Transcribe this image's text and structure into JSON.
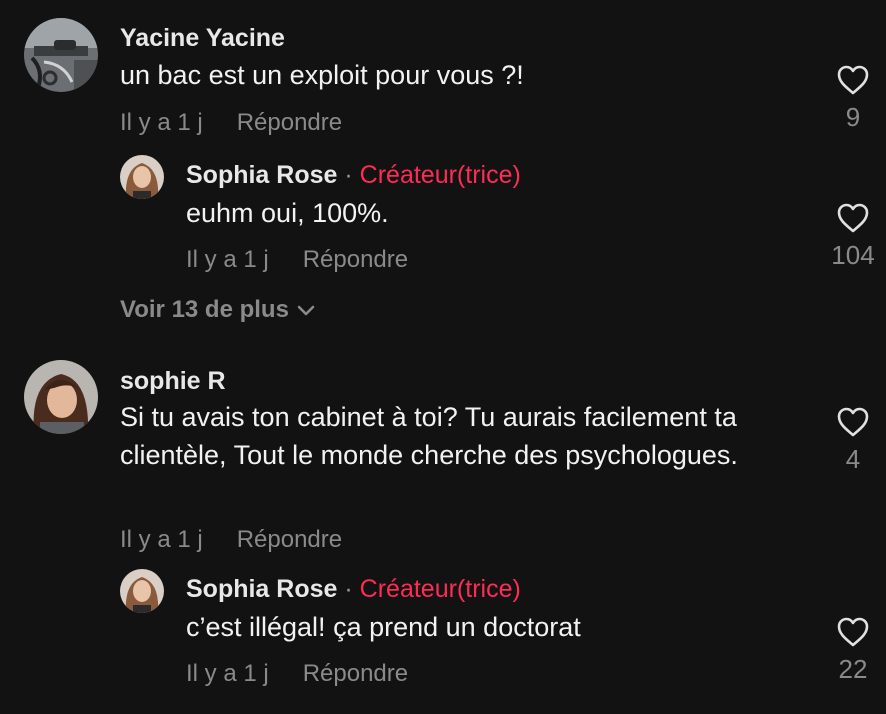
{
  "comments": [
    {
      "user": "Yacine Yacine",
      "text": "un bac est un exploit pour vous ?!",
      "time": "Il y a 1 j",
      "reply": "Répondre",
      "likes": "9"
    },
    {
      "user": "sophie R",
      "text": "Si tu avais ton cabinet à toi? Tu aurais facilement ta clientèle, Tout le monde cherche des psychologues.",
      "time": "Il y a 1 j",
      "reply": "Répondre",
      "likes": "4"
    }
  ],
  "replies": [
    {
      "user": "Sophia Rose",
      "separator": "·",
      "badge": "Créateur(trice)",
      "text": "euhm oui, 100%.",
      "time": "Il y a 1 j",
      "reply": "Répondre",
      "likes": "104"
    },
    {
      "user": "Sophia Rose",
      "separator": "·",
      "badge": "Créateur(trice)",
      "text": "c’est illégal! ça prend un doctorat",
      "time": "Il y a 1 j",
      "reply": "Répondre",
      "likes": "22"
    }
  ],
  "view_more": "Voir 13 de plus",
  "icons": {
    "like": "heart-outline-icon",
    "expand": "chevron-down-icon"
  },
  "colors": {
    "background": "#121212",
    "creator_badge": "#fe2c55",
    "secondary_text": "#8a8a8a"
  }
}
